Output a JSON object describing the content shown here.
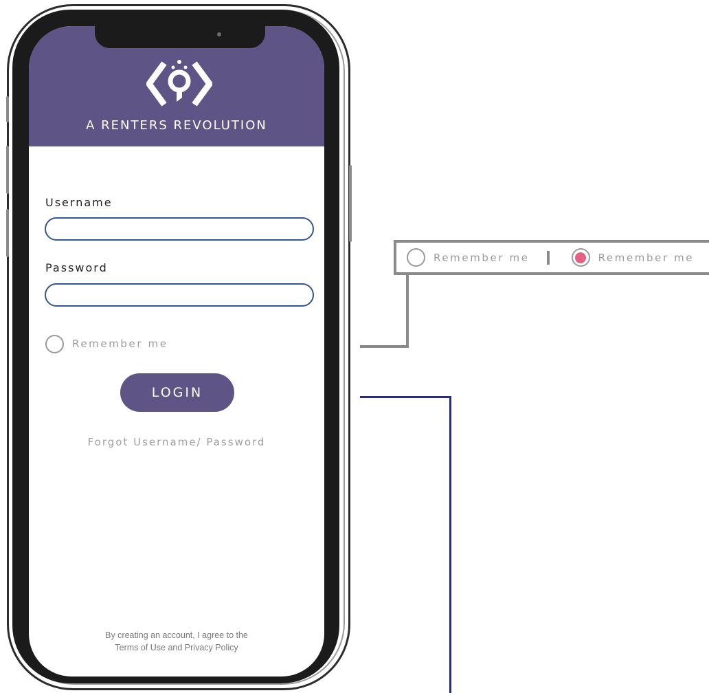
{
  "header": {
    "brand_title": "A RENTERS REVOLUTION",
    "logo_icon": "renters-key-logo-icon",
    "color": "#5e5586"
  },
  "login_form": {
    "username_label": "Username",
    "username_value": "",
    "password_label": "Password",
    "password_value": "",
    "remember_label": "Remember me",
    "remember_checked": false,
    "login_button": "LOGIN",
    "forgot_link": "Forgot Username/ Password",
    "input_border_color": "#35568f"
  },
  "footer": {
    "terms_line1": "By creating an account, I agree to the",
    "terms_line2": "Terms of Use and Privacy Policy"
  },
  "annotation": {
    "unselected_label": "Remember me",
    "selected_label": "Remember me",
    "selected_color": "#e75f83",
    "callout_line_color": "#8a8a8a",
    "login_line_color": "#2a2a7e"
  }
}
